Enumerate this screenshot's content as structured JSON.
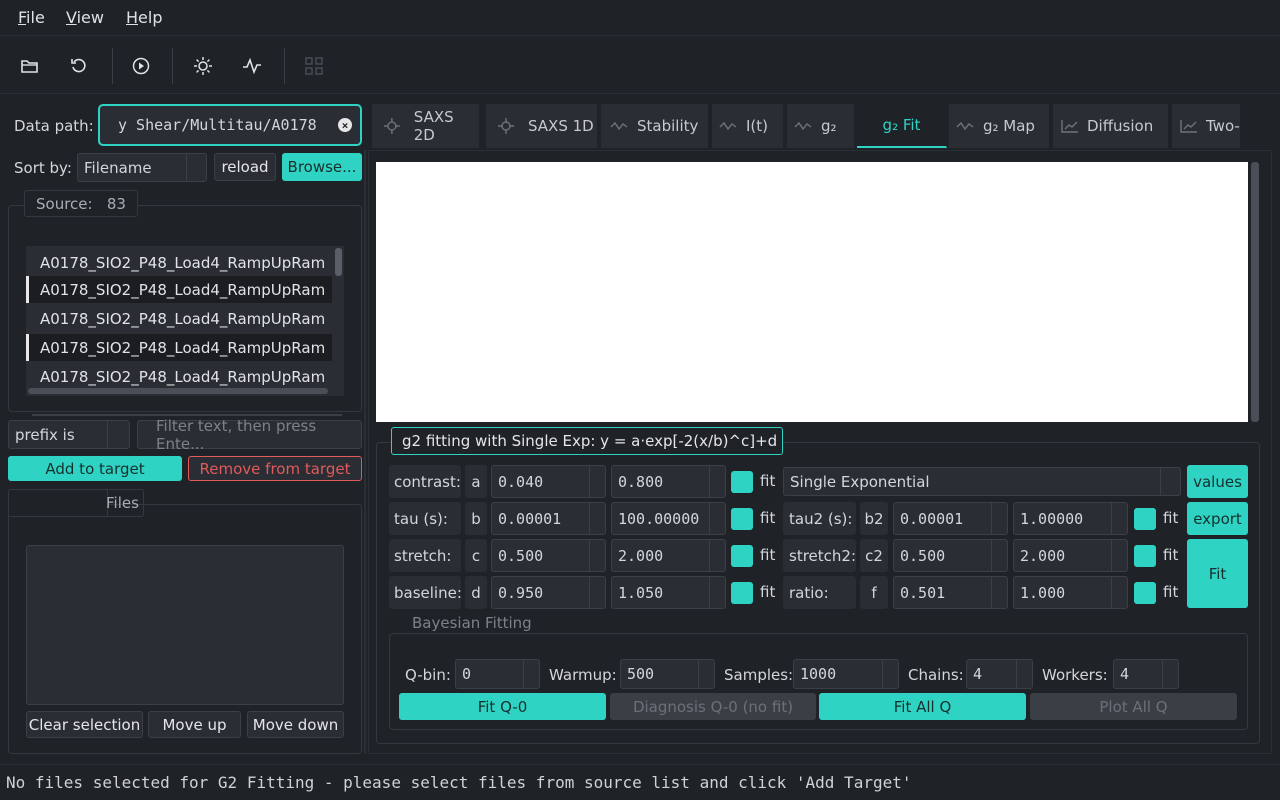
{
  "menu": {
    "file": "File",
    "view": "View",
    "help": "Help"
  },
  "toolbar": {
    "icons": [
      "folder-open-icon",
      "refresh-icon",
      "play-icon",
      "settings-sun-icon",
      "pulse-icon",
      "grid-disabled-icon"
    ]
  },
  "left": {
    "data_path_label": "Data path:",
    "data_path_value": "y Shear/Multitau/A0178",
    "sort_label": "Sort by:",
    "sort_value": "Filename",
    "reload": "reload",
    "browse": "Browse...",
    "source_label": "Source:",
    "source_count": "83",
    "source_items": [
      "A0178_SIO2_P48_Load4_RampUpRam",
      "A0178_SIO2_P48_Load4_RampUpRam",
      "A0178_SIO2_P48_Load4_RampUpRam",
      "A0178_SIO2_P48_Load4_RampUpRam",
      "A0178_SIO2_P48_Load4_RampUpRam"
    ],
    "filter_mode": "prefix is",
    "filter_placeholder": "Filter text, then press Ente...",
    "add_target": "Add to target",
    "remove_target": "Remove from target",
    "files_label": "Files",
    "clear_selection": "Clear selection",
    "move_up": "Move up",
    "move_down": "Move down"
  },
  "tabs": [
    {
      "label": "SAXS 2D",
      "icon": "crosshair-icon"
    },
    {
      "label": "SAXS 1D",
      "icon": "crosshair-icon"
    },
    {
      "label": "Stability",
      "icon": "wave-icon"
    },
    {
      "label": "I(t)",
      "icon": "wave-icon"
    },
    {
      "label": "g₂",
      "icon": "wave-icon"
    },
    {
      "label": "g₂ Fit",
      "icon": ""
    },
    {
      "label": "g₂ Map",
      "icon": "wave-icon"
    },
    {
      "label": "Diffusion",
      "icon": "chart-icon"
    },
    {
      "label": "Two-",
      "icon": "chart-icon"
    }
  ],
  "fit": {
    "group_title": "g2 fitting with Single Exp:  y = a·exp[-2(x/b)^c]+d",
    "rows": [
      {
        "label": "contrast:",
        "sym": "a",
        "min": "0.040",
        "max": "0.800",
        "fit": "fit"
      },
      {
        "label": "tau (s):",
        "sym": "b",
        "min": "0.00001",
        "max": "100.00000",
        "fit": "fit"
      },
      {
        "label": "stretch:",
        "sym": "c",
        "min": "0.500",
        "max": "2.000",
        "fit": "fit"
      },
      {
        "label": "baseline:",
        "sym": "d",
        "min": "0.950",
        "max": "1.050",
        "fit": "fit"
      }
    ],
    "model": "Single Exponential",
    "rows2": [
      {
        "label": "tau2 (s):",
        "sym": "b2",
        "min": "0.00001",
        "max": "1.00000",
        "fit": "fit"
      },
      {
        "label": "stretch2:",
        "sym": "c2",
        "min": "0.500",
        "max": "2.000",
        "fit": "fit"
      },
      {
        "label": "ratio:",
        "sym": "f",
        "min": "0.501",
        "max": "1.000",
        "fit": "fit"
      }
    ],
    "values_btn": "values",
    "export_btn": "export",
    "fit_btn": "Fit"
  },
  "bayes": {
    "title": "Bayesian Fitting",
    "qbin_label": "Q-bin:",
    "qbin": "0",
    "warmup_label": "Warmup:",
    "warmup": "500",
    "samples_label": "Samples:",
    "samples": "1000",
    "chains_label": "Chains:",
    "chains": "4",
    "workers_label": "Workers:",
    "workers": "4",
    "fit_q0": "Fit Q-0",
    "diag_q0": "Diagnosis Q-0 (no fit)",
    "fit_all": "Fit All Q",
    "plot_all": "Plot All Q"
  },
  "status": "No files selected for G2 Fitting - please select files from source list and click 'Add Target'",
  "colors": {
    "accent": "#2fd3c3",
    "danger": "#e05a5a",
    "bg": "#1f2227"
  }
}
